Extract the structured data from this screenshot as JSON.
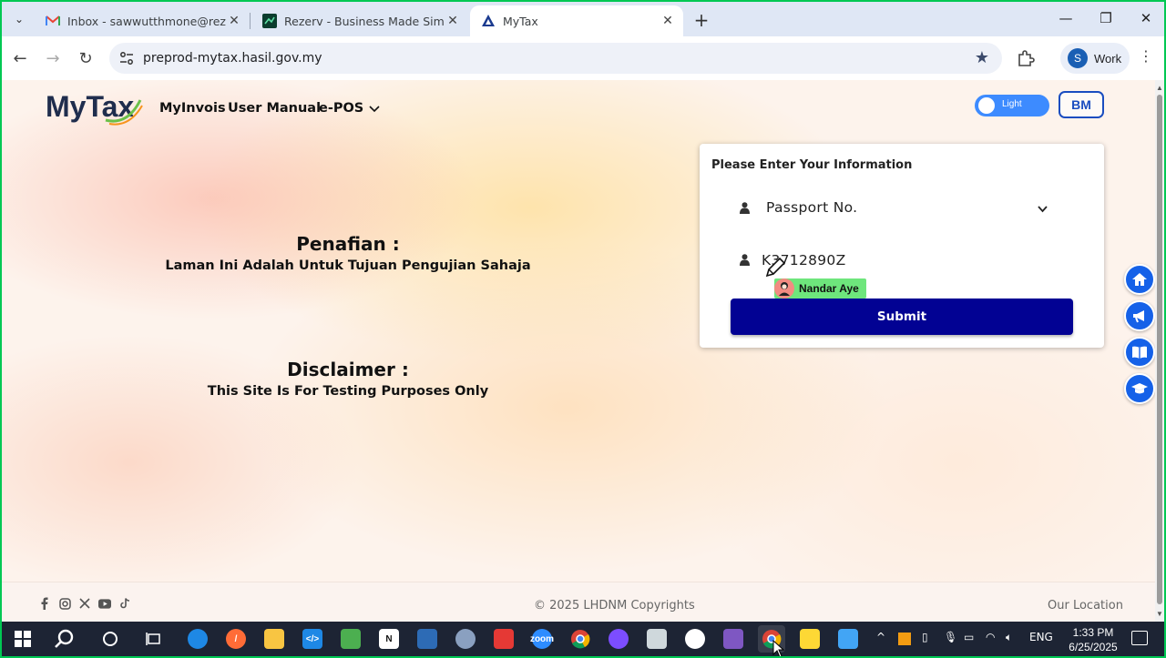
{
  "browser": {
    "tabs": [
      {
        "title": "Inbox - sawwutthmone@rezerv",
        "favicon": "gmail-icon"
      },
      {
        "title": "Rezerv - Business Made Simple",
        "favicon": "rezerv-icon"
      },
      {
        "title": "MyTax",
        "favicon": "mytax-icon"
      }
    ],
    "url": "preprod-mytax.hasil.gov.my",
    "profile_initial": "S",
    "profile_name": "Work"
  },
  "header": {
    "logo_text": "MyTax",
    "nav": [
      "MyInvois",
      "User Manual",
      "e-POS"
    ],
    "theme_label": "Light",
    "lang_label": "BM"
  },
  "disclaimer": {
    "ms_title": "Penafian :",
    "ms_text": "Laman Ini Adalah Untuk Tujuan Pengujian Sahaja",
    "en_title": "Disclaimer :",
    "en_text": "This Site Is For Testing Purposes Only"
  },
  "form": {
    "title": "Please Enter Your Information",
    "id_type": "Passport No.",
    "id_value": "K3712890Z",
    "submit_label": "Submit",
    "collaborator_name": "Nandar Aye"
  },
  "footer": {
    "copyright": "© 2025 LHDNM Copyrights",
    "location_label": "Our Location"
  },
  "taskbar": {
    "lang": "ENG",
    "time": "1:33 PM",
    "date": "6/25/2025"
  },
  "colors": {
    "submit": "#020293",
    "accent": "#1561e8",
    "toggle": "#3d8bff"
  }
}
